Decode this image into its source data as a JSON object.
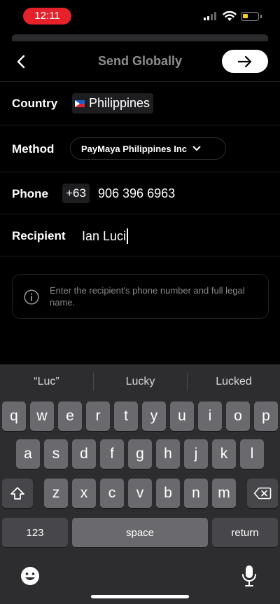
{
  "status": {
    "time": "12:11"
  },
  "header": {
    "title": "Send Globally"
  },
  "form": {
    "country_label": "Country",
    "country_value": "Philippines",
    "method_label": "Method",
    "method_value": "PayMaya Philippines Inc",
    "phone_label": "Phone",
    "phone_code": "+63",
    "phone_value": "906 396 6963",
    "recipient_label": "Recipient",
    "recipient_value": "Ian Luci"
  },
  "info": {
    "text": "Enter the recipient's phone number and full legal name."
  },
  "keyboard": {
    "suggestions": [
      "“Luc”",
      "Lucky",
      "Lucked"
    ],
    "row1": [
      "q",
      "w",
      "e",
      "r",
      "t",
      "y",
      "u",
      "i",
      "o",
      "p"
    ],
    "row2": [
      "a",
      "s",
      "d",
      "f",
      "g",
      "h",
      "j",
      "k",
      "l"
    ],
    "row3": [
      "z",
      "x",
      "c",
      "v",
      "b",
      "n",
      "m"
    ],
    "numbers_label": "123",
    "space_label": "space",
    "return_label": "return"
  },
  "colors": {
    "accent_red": "#e5222b",
    "battery_yellow": "#f5d60c",
    "flag_blue": "#1c5fd1",
    "flag_red": "#d9262d"
  },
  "icons": [
    "back-arrow-icon",
    "forward-arrow-icon",
    "flag-icon",
    "chevron-down-icon",
    "info-icon",
    "shift-icon",
    "delete-icon",
    "emoji-icon",
    "microphone-icon",
    "wifi-icon",
    "signal-icon",
    "battery-icon"
  ]
}
